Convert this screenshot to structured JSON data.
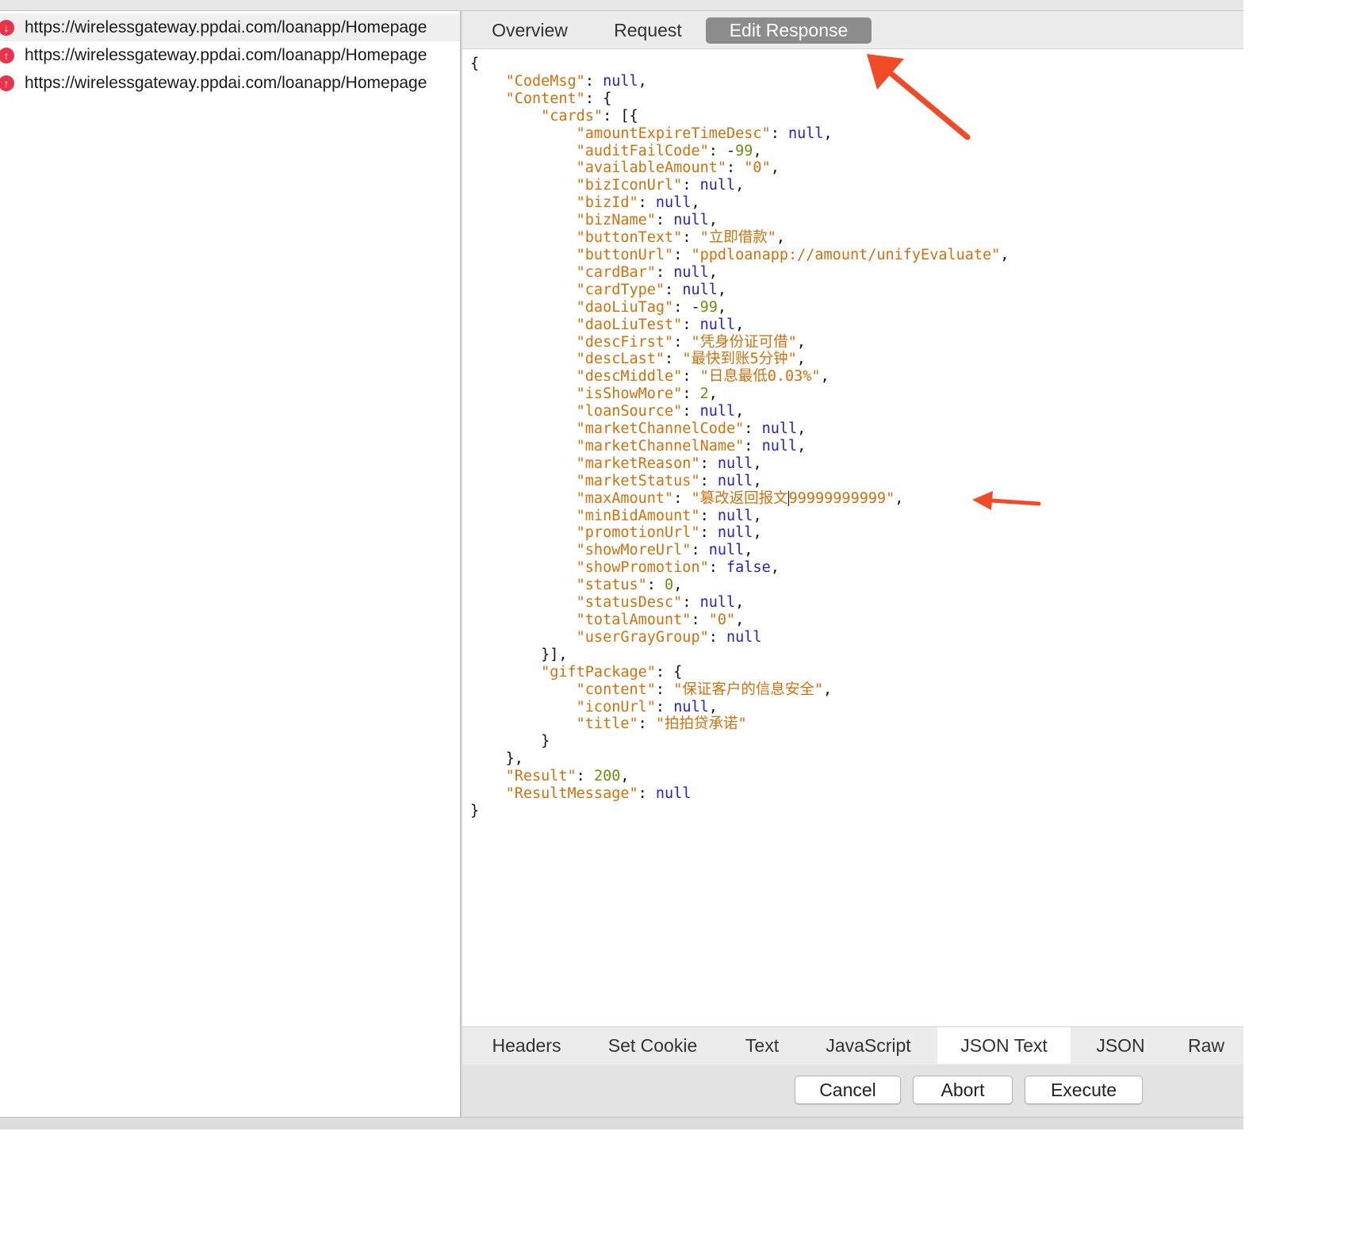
{
  "requests": [
    {
      "url": "https://wirelessgateway.ppdai.com/loanapp/Homepage",
      "direction": "response",
      "icon": "arrow-down-icon"
    },
    {
      "url": "https://wirelessgateway.ppdai.com/loanapp/Homepage",
      "direction": "request",
      "icon": "arrow-up-icon"
    },
    {
      "url": "https://wirelessgateway.ppdai.com/loanapp/Homepage",
      "direction": "request",
      "icon": "arrow-up-icon"
    }
  ],
  "top_tabs": [
    {
      "label": "Overview",
      "active": false
    },
    {
      "label": "Request",
      "active": false
    },
    {
      "label": "Edit Response",
      "active": true
    }
  ],
  "json_lines": [
    {
      "indent": 0,
      "tokens": [
        [
          "p",
          "{"
        ]
      ]
    },
    {
      "indent": 1,
      "tokens": [
        [
          "k",
          "\"CodeMsg\""
        ],
        [
          "p",
          ": "
        ],
        [
          "n",
          "null"
        ],
        [
          "p",
          ","
        ]
      ]
    },
    {
      "indent": 1,
      "tokens": [
        [
          "k",
          "\"Content\""
        ],
        [
          "p",
          ": {"
        ]
      ]
    },
    {
      "indent": 2,
      "tokens": [
        [
          "k",
          "\"cards\""
        ],
        [
          "p",
          ": [{"
        ]
      ]
    },
    {
      "indent": 3,
      "tokens": [
        [
          "k",
          "\"amountExpireTimeDesc\""
        ],
        [
          "p",
          ": "
        ],
        [
          "n",
          "null"
        ],
        [
          "p",
          ","
        ]
      ]
    },
    {
      "indent": 3,
      "tokens": [
        [
          "k",
          "\"auditFailCode\""
        ],
        [
          "p",
          ": -"
        ],
        [
          "num",
          "99"
        ],
        [
          "p",
          ","
        ]
      ]
    },
    {
      "indent": 3,
      "tokens": [
        [
          "k",
          "\"availableAmount\""
        ],
        [
          "p",
          ": "
        ],
        [
          "s",
          "\"0\""
        ],
        [
          "p",
          ","
        ]
      ]
    },
    {
      "indent": 3,
      "tokens": [
        [
          "k",
          "\"bizIconUrl\""
        ],
        [
          "p",
          ": "
        ],
        [
          "n",
          "null"
        ],
        [
          "p",
          ","
        ]
      ]
    },
    {
      "indent": 3,
      "tokens": [
        [
          "k",
          "\"bizId\""
        ],
        [
          "p",
          ": "
        ],
        [
          "n",
          "null"
        ],
        [
          "p",
          ","
        ]
      ]
    },
    {
      "indent": 3,
      "tokens": [
        [
          "k",
          "\"bizName\""
        ],
        [
          "p",
          ": "
        ],
        [
          "n",
          "null"
        ],
        [
          "p",
          ","
        ]
      ]
    },
    {
      "indent": 3,
      "tokens": [
        [
          "k",
          "\"buttonText\""
        ],
        [
          "p",
          ": "
        ],
        [
          "s",
          "\"立即借款\""
        ],
        [
          "p",
          ","
        ]
      ]
    },
    {
      "indent": 3,
      "tokens": [
        [
          "k",
          "\"buttonUrl\""
        ],
        [
          "p",
          ": "
        ],
        [
          "s",
          "\"ppdloanapp://amount/unifyEvaluate\""
        ],
        [
          "p",
          ","
        ]
      ]
    },
    {
      "indent": 3,
      "tokens": [
        [
          "k",
          "\"cardBar\""
        ],
        [
          "p",
          ": "
        ],
        [
          "n",
          "null"
        ],
        [
          "p",
          ","
        ]
      ]
    },
    {
      "indent": 3,
      "tokens": [
        [
          "k",
          "\"cardType\""
        ],
        [
          "p",
          ": "
        ],
        [
          "n",
          "null"
        ],
        [
          "p",
          ","
        ]
      ]
    },
    {
      "indent": 3,
      "tokens": [
        [
          "k",
          "\"daoLiuTag\""
        ],
        [
          "p",
          ": -"
        ],
        [
          "num",
          "99"
        ],
        [
          "p",
          ","
        ]
      ]
    },
    {
      "indent": 3,
      "tokens": [
        [
          "k",
          "\"daoLiuTest\""
        ],
        [
          "p",
          ": "
        ],
        [
          "n",
          "null"
        ],
        [
          "p",
          ","
        ]
      ]
    },
    {
      "indent": 3,
      "tokens": [
        [
          "k",
          "\"descFirst\""
        ],
        [
          "p",
          ": "
        ],
        [
          "s",
          "\"凭身份证可借\""
        ],
        [
          "p",
          ","
        ]
      ]
    },
    {
      "indent": 3,
      "tokens": [
        [
          "k",
          "\"descLast\""
        ],
        [
          "p",
          ": "
        ],
        [
          "s",
          "\"最快到账5分钟\""
        ],
        [
          "p",
          ","
        ]
      ]
    },
    {
      "indent": 3,
      "tokens": [
        [
          "k",
          "\"descMiddle\""
        ],
        [
          "p",
          ": "
        ],
        [
          "s",
          "\"日息最低0.03%\""
        ],
        [
          "p",
          ","
        ]
      ]
    },
    {
      "indent": 3,
      "tokens": [
        [
          "k",
          "\"isShowMore\""
        ],
        [
          "p",
          ": "
        ],
        [
          "num",
          "2"
        ],
        [
          "p",
          ","
        ]
      ]
    },
    {
      "indent": 3,
      "tokens": [
        [
          "k",
          "\"loanSource\""
        ],
        [
          "p",
          ": "
        ],
        [
          "n",
          "null"
        ],
        [
          "p",
          ","
        ]
      ]
    },
    {
      "indent": 3,
      "tokens": [
        [
          "k",
          "\"marketChannelCode\""
        ],
        [
          "p",
          ": "
        ],
        [
          "n",
          "null"
        ],
        [
          "p",
          ","
        ]
      ]
    },
    {
      "indent": 3,
      "tokens": [
        [
          "k",
          "\"marketChannelName\""
        ],
        [
          "p",
          ": "
        ],
        [
          "n",
          "null"
        ],
        [
          "p",
          ","
        ]
      ]
    },
    {
      "indent": 3,
      "tokens": [
        [
          "k",
          "\"marketReason\""
        ],
        [
          "p",
          ": "
        ],
        [
          "n",
          "null"
        ],
        [
          "p",
          ","
        ]
      ]
    },
    {
      "indent": 3,
      "tokens": [
        [
          "k",
          "\"marketStatus\""
        ],
        [
          "p",
          ": "
        ],
        [
          "n",
          "null"
        ],
        [
          "p",
          ","
        ]
      ]
    },
    {
      "indent": 3,
      "tokens": [
        [
          "k",
          "\"maxAmount\""
        ],
        [
          "p",
          ": "
        ],
        [
          "s",
          "\"篡改返回报文"
        ],
        [
          "caret",
          ""
        ],
        [
          "s",
          "99999999999\""
        ],
        [
          "p",
          ","
        ]
      ]
    },
    {
      "indent": 3,
      "tokens": [
        [
          "k",
          "\"minBidAmount\""
        ],
        [
          "p",
          ": "
        ],
        [
          "n",
          "null"
        ],
        [
          "p",
          ","
        ]
      ]
    },
    {
      "indent": 3,
      "tokens": [
        [
          "k",
          "\"promotionUrl\""
        ],
        [
          "p",
          ": "
        ],
        [
          "n",
          "null"
        ],
        [
          "p",
          ","
        ]
      ]
    },
    {
      "indent": 3,
      "tokens": [
        [
          "k",
          "\"showMoreUrl\""
        ],
        [
          "p",
          ": "
        ],
        [
          "n",
          "null"
        ],
        [
          "p",
          ","
        ]
      ]
    },
    {
      "indent": 3,
      "tokens": [
        [
          "k",
          "\"showPromotion\""
        ],
        [
          "p",
          ": "
        ],
        [
          "n",
          "false"
        ],
        [
          "p",
          ","
        ]
      ]
    },
    {
      "indent": 3,
      "tokens": [
        [
          "k",
          "\"status\""
        ],
        [
          "p",
          ": "
        ],
        [
          "num",
          "0"
        ],
        [
          "p",
          ","
        ]
      ]
    },
    {
      "indent": 3,
      "tokens": [
        [
          "k",
          "\"statusDesc\""
        ],
        [
          "p",
          ": "
        ],
        [
          "n",
          "null"
        ],
        [
          "p",
          ","
        ]
      ]
    },
    {
      "indent": 3,
      "tokens": [
        [
          "k",
          "\"totalAmount\""
        ],
        [
          "p",
          ": "
        ],
        [
          "s",
          "\"0\""
        ],
        [
          "p",
          ","
        ]
      ]
    },
    {
      "indent": 3,
      "tokens": [
        [
          "k",
          "\"userGrayGroup\""
        ],
        [
          "p",
          ": "
        ],
        [
          "n",
          "null"
        ]
      ]
    },
    {
      "indent": 2,
      "tokens": [
        [
          "p",
          "}],"
        ]
      ]
    },
    {
      "indent": 2,
      "tokens": [
        [
          "k",
          "\"giftPackage\""
        ],
        [
          "p",
          ": {"
        ]
      ]
    },
    {
      "indent": 3,
      "tokens": [
        [
          "k",
          "\"content\""
        ],
        [
          "p",
          ": "
        ],
        [
          "s",
          "\"保证客户的信息安全\""
        ],
        [
          "p",
          ","
        ]
      ]
    },
    {
      "indent": 3,
      "tokens": [
        [
          "k",
          "\"iconUrl\""
        ],
        [
          "p",
          ": "
        ],
        [
          "n",
          "null"
        ],
        [
          "p",
          ","
        ]
      ]
    },
    {
      "indent": 3,
      "tokens": [
        [
          "k",
          "\"title\""
        ],
        [
          "p",
          ": "
        ],
        [
          "s",
          "\"拍拍贷承诺\""
        ]
      ]
    },
    {
      "indent": 2,
      "tokens": [
        [
          "p",
          "}"
        ]
      ]
    },
    {
      "indent": 1,
      "tokens": [
        [
          "p",
          "},"
        ]
      ]
    },
    {
      "indent": 1,
      "tokens": [
        [
          "k",
          "\"Result\""
        ],
        [
          "p",
          ": "
        ],
        [
          "num",
          "200"
        ],
        [
          "p",
          ","
        ]
      ]
    },
    {
      "indent": 1,
      "tokens": [
        [
          "k",
          "\"ResultMessage\""
        ],
        [
          "p",
          ": "
        ],
        [
          "n",
          "null"
        ]
      ]
    },
    {
      "indent": 0,
      "tokens": [
        [
          "p",
          "}"
        ]
      ]
    }
  ],
  "bottom_tabs": [
    {
      "label": "Headers",
      "active": false
    },
    {
      "label": "Set Cookie",
      "active": false
    },
    {
      "label": "Text",
      "active": false
    },
    {
      "label": "JavaScript",
      "active": false
    },
    {
      "label": "JSON Text",
      "active": true
    },
    {
      "label": "JSON",
      "active": false
    },
    {
      "label": "Raw",
      "active": false
    }
  ],
  "buttons": {
    "cancel": "Cancel",
    "abort": "Abort",
    "execute": "Execute"
  },
  "colors": {
    "key_string": "#d4700b",
    "null_bool": "#2323c8",
    "number": "#6c8e10",
    "annotation_arrow": "#f04a26",
    "request_icon": "#e8334a"
  }
}
